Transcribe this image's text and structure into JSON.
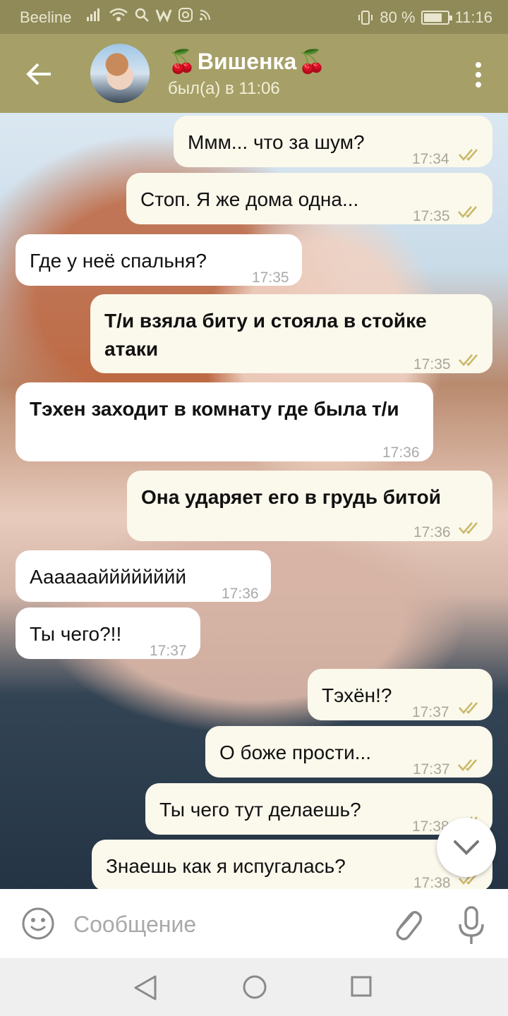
{
  "status_bar": {
    "carrier": "Beeline",
    "battery_text": "80 %",
    "battery_level": 0.8,
    "time": "11:16"
  },
  "header": {
    "title": "Вишенка",
    "title_emoji": "🍒",
    "last_seen": "был(а) в 11:06"
  },
  "messages": [
    {
      "direction": "out",
      "text": "Ммм... что за шум?",
      "time": "17:34",
      "read": true
    },
    {
      "direction": "out",
      "text": "Стоп. Я же дома одна...",
      "time": "17:35",
      "read": true
    },
    {
      "direction": "in",
      "text": "Где у неё спальня?",
      "time": "17:35"
    },
    {
      "direction": "out",
      "text": "Т/и взяла биту и стояла в стойке атаки",
      "time": "17:35",
      "read": true,
      "bold": true
    },
    {
      "direction": "in",
      "text": "Тэхен заходит в комнату где была т/и",
      "time": "17:36",
      "bold": true
    },
    {
      "direction": "out",
      "text": "Она ударяет его в грудь битой",
      "time": "17:36",
      "read": true,
      "bold": true
    },
    {
      "direction": "in",
      "text": "Аааааайййййййй",
      "time": "17:36"
    },
    {
      "direction": "in",
      "text": "Ты чего?!!",
      "time": "17:37"
    },
    {
      "direction": "out",
      "text": "Тэхён!?",
      "time": "17:37",
      "read": true
    },
    {
      "direction": "out",
      "text": "О боже прости...",
      "time": "17:37",
      "read": true
    },
    {
      "direction": "out",
      "text": "Ты чего тут делаешь?",
      "time": "17:38",
      "read": true
    },
    {
      "direction": "out",
      "text": "Знаешь как я испугалась?",
      "time": "17:38",
      "read": true
    }
  ],
  "input": {
    "placeholder": "Сообщение"
  },
  "colors": {
    "header": "#a6a068",
    "status_bar": "#8f8a58",
    "outgoing_bubble": "#fbf8ec",
    "incoming_bubble": "#ffffff",
    "read_check": "#c9b866"
  },
  "icons": [
    "back-arrow-icon",
    "more-vertical-icon",
    "emoji-icon",
    "attach-icon",
    "microphone-icon",
    "chevron-down-icon",
    "double-check-icon"
  ]
}
